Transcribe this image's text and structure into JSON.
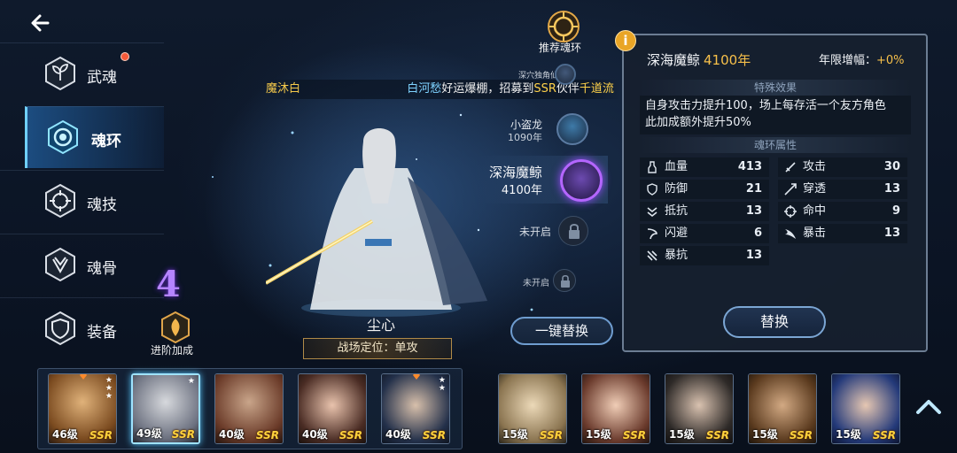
{
  "nav": {
    "back_icon": "back-arrow-icon",
    "items": [
      {
        "label": "武魂",
        "icon": "sprout-icon"
      },
      {
        "label": "魂环",
        "icon": "ring-icon"
      },
      {
        "label": "魂技",
        "icon": "crosshair-icon"
      },
      {
        "label": "魂骨",
        "icon": "skull-icon"
      },
      {
        "label": "装备",
        "icon": "shield-icon"
      }
    ],
    "active_index": 1
  },
  "advance": {
    "number": "4",
    "label": "进阶加成"
  },
  "recommend": {
    "label": "推荐魂环"
  },
  "banner": {
    "part1": "魔沐白",
    "part2": "白河愁",
    "part3": "好运爆棚，招募到",
    "part4": "SSR",
    "part5": "伙伴",
    "part6": "千道流"
  },
  "character": {
    "name": "尘心",
    "role": "战场定位：单攻"
  },
  "rings": [
    {
      "name": "深穴独角仙",
      "year": ""
    },
    {
      "name": "小盗龙",
      "year": "1090年"
    },
    {
      "name": "深海魔鲸",
      "year": "4100年"
    },
    {
      "name": "未开启",
      "year": ""
    },
    {
      "name": "未开启",
      "year": ""
    }
  ],
  "replace_all_label": "一键替换",
  "panel": {
    "title": "深海魔鲸",
    "title_years": "4100年",
    "growth_label": "年限增幅：",
    "growth_value": "+0%",
    "special_head": "特殊效果",
    "effect_line1": "自身攻击力提升100，场上每存活一个友方角色",
    "effect_line2": "此加成额外提升50%",
    "attr_head": "魂环属性",
    "stats_left": [
      {
        "name": "血量",
        "value": "413",
        "icon": "potion-icon"
      },
      {
        "name": "防御",
        "value": "21",
        "icon": "shield-icon"
      },
      {
        "name": "抵抗",
        "value": "13",
        "icon": "resist-icon"
      },
      {
        "name": "闪避",
        "value": "6",
        "icon": "dodge-icon"
      },
      {
        "name": "暴抗",
        "value": "13",
        "icon": "crit-resist-icon"
      }
    ],
    "stats_right": [
      {
        "name": "攻击",
        "value": "30",
        "icon": "sword-icon"
      },
      {
        "name": "穿透",
        "value": "13",
        "icon": "pierce-icon"
      },
      {
        "name": "命中",
        "value": "9",
        "icon": "target-icon"
      },
      {
        "name": "暴击",
        "value": "13",
        "icon": "crit-icon"
      }
    ],
    "replace_label": "替换"
  },
  "roster_left": [
    {
      "level": "46级",
      "rarity": "SSR",
      "stars": 3,
      "color": "#c48a3c"
    },
    {
      "level": "49级",
      "rarity": "SSR",
      "stars": 1,
      "color": "#8a8f99"
    },
    {
      "level": "40级",
      "rarity": "SSR",
      "stars": 0,
      "color": "#7a4f3a"
    },
    {
      "level": "40级",
      "rarity": "SSR",
      "stars": 0,
      "color": "#5a3a30"
    },
    {
      "level": "40级",
      "rarity": "SSR",
      "stars": 2,
      "color": "#2c3a55"
    }
  ],
  "roster_right": [
    {
      "level": "15级",
      "rarity": "SSR",
      "color": "#b59a6a"
    },
    {
      "level": "15级",
      "rarity": "SSR",
      "color": "#7a4a3a"
    },
    {
      "level": "15级",
      "rarity": "SSR",
      "color": "#3a3430"
    },
    {
      "level": "15级",
      "rarity": "SSR",
      "color": "#6a4a2a"
    },
    {
      "level": "15级",
      "rarity": "SSR",
      "color": "#2c3d7a"
    }
  ]
}
